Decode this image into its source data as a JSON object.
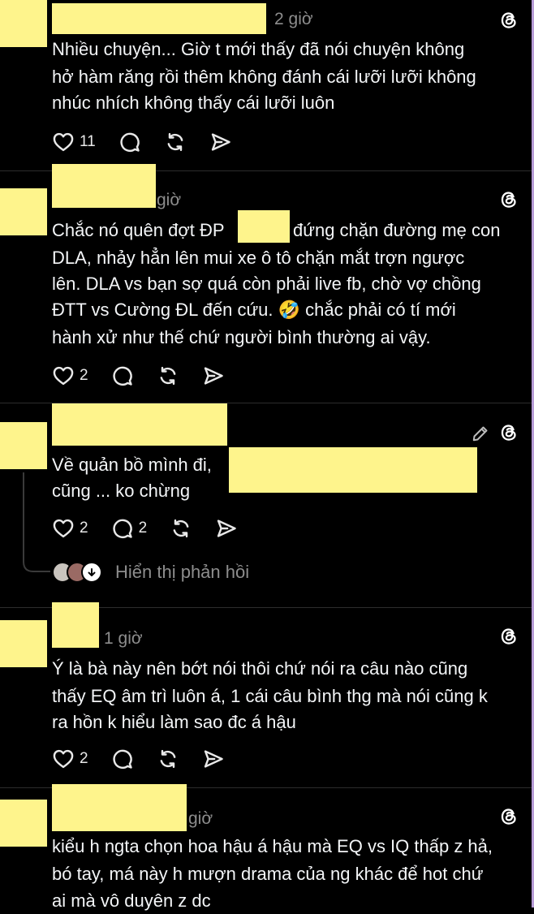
{
  "posts": [
    {
      "time": "2 giờ",
      "lines": [
        "Nhiều chuyện... Giờ t mới thấy đã nói chuyện không",
        "hở hàm răng rồi thêm không đánh cái lưỡi lưỡi không",
        "nhúc nhích không thấy cái lưỡi luôn"
      ],
      "likes": "11",
      "comments": ""
    },
    {
      "time": "giờ",
      "lines": [
        "Chắc nó quên đợt ĐP",
        "DLA, nhảy hẳn lên mui xe ô tô chặn mắt trợn ngược",
        "lên. DLA vs bạn sợ quá còn phải live fb, chờ vợ chồng",
        "ĐTT vs Cường ĐL đến cứu. 🤣 chắc phải có tí mới",
        "hành xử như thế chứ người bình thường ai vậy."
      ],
      "line0_tail": "đứng chặn đường mẹ con",
      "likes": "2",
      "comments": ""
    },
    {
      "time": "",
      "lines": [
        "Về quản bồ mình đi,",
        "cũng ... ko chừng"
      ],
      "likes": "2",
      "comments": "2",
      "replies_label": "Hiển thị phản hồi"
    },
    {
      "time": "1 giờ",
      "lines": [
        "Ý là bà này nên bớt nói thôi chứ nói ra câu nào cũng",
        "thấy EQ âm trì luôn á, 1 cái câu bình thg mà nói cũng k",
        "ra hồn k hiểu làm sao đc á hậu"
      ],
      "likes": "2",
      "comments": ""
    },
    {
      "time": "giờ",
      "lines": [
        "kiểu h ngta chọn hoa hậu á hậu mà EQ vs IQ thấp z hả,",
        "bó tay, má này h mượn drama của ng khác để hot chứ",
        "ai mà vô duyên z dc"
      ]
    }
  ],
  "colors": {
    "background": "#000000",
    "text": "#f3f5f7",
    "muted": "#8d8d8d",
    "redaction": "#fef48c"
  },
  "icons": [
    "heart-icon",
    "comment-icon",
    "repost-icon",
    "share-icon",
    "threads-logo-icon",
    "edit-icon",
    "chevron-down-icon"
  ]
}
